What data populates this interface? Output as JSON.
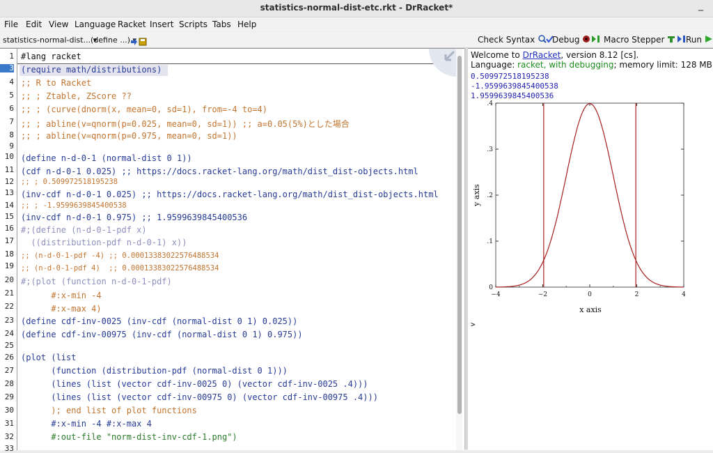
{
  "window": {
    "title": "statistics-normal-dist-etc.rkt - DrRacket*",
    "minimize_glyph": "_"
  },
  "menu": [
    "File",
    "Edit",
    "View",
    "Language",
    "Racket",
    "Insert",
    "Scripts",
    "Tabs",
    "Help"
  ],
  "toolbar": {
    "file_dropdown": "statistics-normal-dist...",
    "define_dropdown": "(define ...)",
    "check_syntax": "Check Syntax",
    "debug": "Debug",
    "macro_stepper": "Macro Stepper",
    "run": "Run"
  },
  "editor": {
    "line_numbers": [
      "1",
      "3",
      "4",
      "5",
      "6",
      "7",
      "8",
      "9",
      "10",
      "11",
      "12",
      "13",
      "14",
      "15",
      "16",
      "17",
      "18",
      "19",
      "20",
      "21",
      "22",
      "23",
      "24",
      "25",
      "26",
      "27",
      "28",
      "29",
      "30",
      "31",
      "32",
      "33"
    ],
    "lines": [
      "#lang racket",
      "(require math/distributions)",
      ";; R to Racket",
      ";; ; Ztable, ZScore ??",
      ";; ; (curve(dnorm(x, mean=0, sd=1), from=-4 to=4)",
      ";; ; abline(v=qnorm(p=0.025, mean=0, sd=1)) ;; a=0.05(5%)とした場合",
      ";; ; abline(v=qnorm(p=0.975, mean=0, sd=1))",
      "",
      "(define n-d-0-1 (normal-dist 0 1))",
      "(cdf n-d-0-1 0.025) ;; https://docs.racket-lang.org/math/dist_dist-objects.html",
      ";; ; 0.509972518195238",
      "(inv-cdf n-d-0-1 0.025) ;; https://docs.racket-lang.org/math/dist_dist-objects.html",
      ";; ; -1.9599639845400538",
      "(inv-cdf n-d-0-1 0.975) ;; 1.9599639845400536",
      "#;(define (n-d-0-1-pdf x)",
      "  ((distribution-pdf n-d-0-1) x))",
      ";; (n-d-0-1-pdf -4) ;; 0.00013383022576488534",
      ";; (n-d-0-1-pdf 4)  ;; 0.00013383022576488534",
      "#;(plot (function n-d-0-1-pdf)",
      "      #:x-min -4",
      "      #:x-max 4)",
      "(define cdf-inv-0025 (inv-cdf (normal-dist 0 1) 0.025))",
      "(define cdf-inv-00975 (inv-cdf (normal-dist 0 1) 0.975))",
      "",
      "(plot (list",
      "      (function (distribution-pdf (normal-dist 0 1)))",
      "      (lines (list (vector cdf-inv-0025 0) (vector cdf-inv-0025 .4)))",
      "      (lines (list (vector cdf-inv-00975 0) (vector cdf-inv-00975 .4)))",
      "      ); end list of plot functions",
      "      #:x-min -4 #:x-max 4",
      "      #:out-file \"norm-dist-inv-cdf-1.png\")",
      ""
    ]
  },
  "interactions": {
    "welcome_prefix": "Welcome to ",
    "welcome_link": "DrRacket",
    "welcome_suffix": ", version 8.12 [cs].",
    "language_prefix": "Language: ",
    "language_name": "racket, with debugging",
    "language_suffix": "; memory limit: 128 MB.",
    "outputs": [
      "0.509972518195238",
      "-1.9599639845400538",
      "1.9599639845400536"
    ],
    "prompt": ">"
  },
  "chart_data": {
    "type": "line",
    "xlabel": "x axis",
    "ylabel": "y axis",
    "xlim": [
      -4,
      4
    ],
    "ylim": [
      0,
      0.4
    ],
    "x_ticks": [
      "−4",
      "−2",
      "0",
      "2",
      "4"
    ],
    "y_ticks": [
      "0",
      ".1",
      ".2",
      ".3",
      ".4"
    ],
    "series": [
      {
        "kind": "normal-pdf",
        "mean": 0,
        "sd": 1
      },
      {
        "kind": "vline",
        "x": -1.96,
        "y": [
          0,
          0.4
        ]
      },
      {
        "kind": "vline",
        "x": 1.96,
        "y": [
          0,
          0.4
        ]
      }
    ],
    "color": "#a51d1d"
  }
}
